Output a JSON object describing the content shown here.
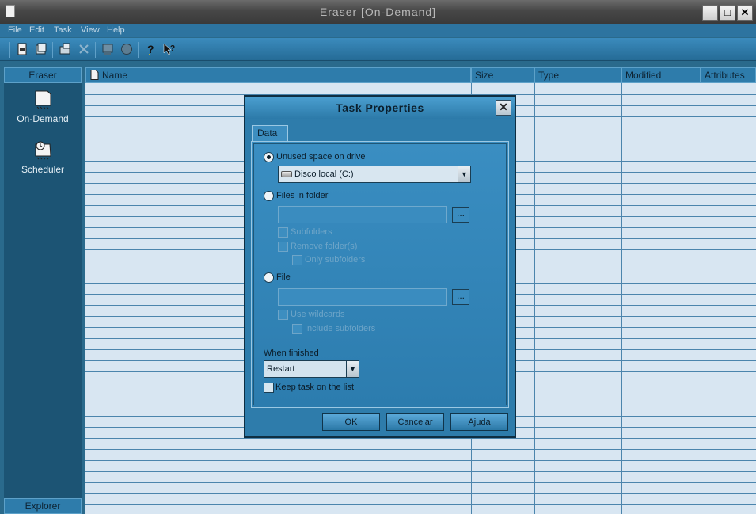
{
  "window": {
    "title": "Eraser  [On-Demand]"
  },
  "menu": [
    "File",
    "Edit",
    "Task",
    "View",
    "Help"
  ],
  "toolbar": {
    "icons": [
      "new-task-icon",
      "new-task-wizard-icon",
      "properties-icon",
      "delete-icon",
      "run-icon",
      "stop-icon",
      "help-icon",
      "context-help-icon"
    ]
  },
  "left_pane": {
    "header": "Eraser",
    "items": [
      {
        "label": "On-Demand",
        "icon": "on-demand-icon"
      },
      {
        "label": "Scheduler",
        "icon": "scheduler-icon"
      }
    ],
    "footer": "Explorer"
  },
  "list": {
    "columns": [
      "Name",
      "Size",
      "Type",
      "Modified",
      "Attributes"
    ]
  },
  "dialog": {
    "title": "Task Properties",
    "close": "✕",
    "tab": "Data",
    "options": {
      "unused_space": "Unused space on drive",
      "drive_value": "Disco local (C:)",
      "files_in_folder": "Files in folder",
      "subfolders": "Subfolders",
      "remove_folders": "Remove folder(s)",
      "only_subfolders": "Only subfolders",
      "file": "File",
      "use_wildcards": "Use wildcards",
      "include_subfolders": "Include subfolders"
    },
    "browse_label": "...",
    "when_finished_label": "When finished",
    "when_finished_value": "Restart",
    "keep_task": "Keep task on the list",
    "buttons": {
      "ok": "OK",
      "cancel": "Cancelar",
      "help": "Ajuda"
    }
  }
}
